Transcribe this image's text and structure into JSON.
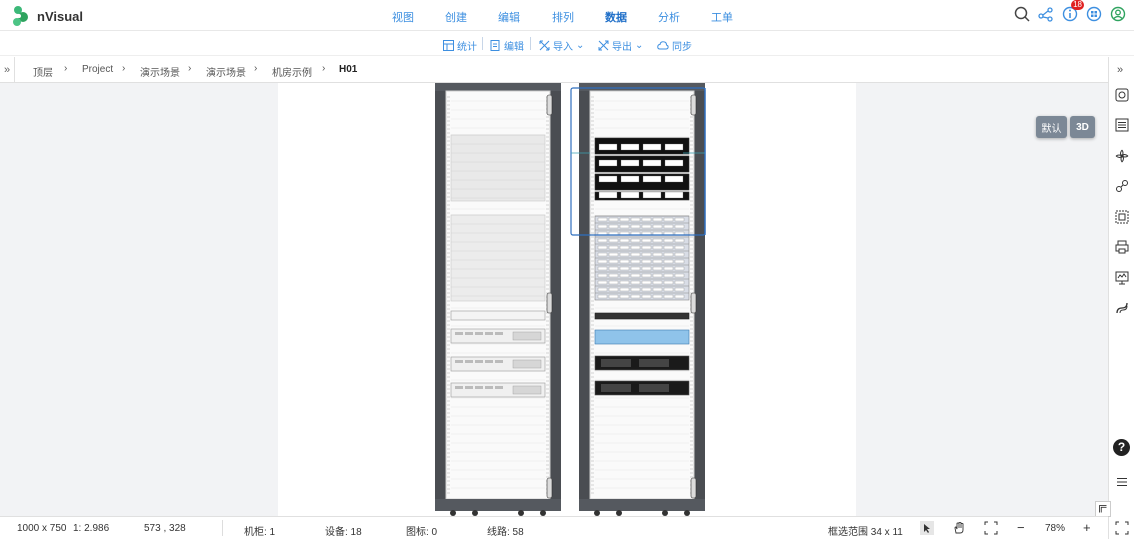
{
  "app": {
    "name": "nVisual"
  },
  "nav": {
    "items": [
      "视图",
      "创建",
      "编辑",
      "排列",
      "数据",
      "分析",
      "工单"
    ],
    "active": "数据"
  },
  "notifications": {
    "count": "18"
  },
  "subtoolbar": {
    "stats": "统计",
    "edit": "编辑",
    "import": "导入",
    "export": "导出",
    "sync": "同步"
  },
  "breadcrumb": [
    "顶层",
    "Project",
    "演示场景",
    "演示场景",
    "机房示例",
    "H01"
  ],
  "view_buttons": {
    "default": "默认",
    "three_d": "3D"
  },
  "status": {
    "canvas_size": "1000 x 750",
    "scale": "1: 2.986",
    "cursor": "573 , 328",
    "cabinets": "机柜: 1",
    "devices": "设备: 18",
    "icons": "图标: 0",
    "lines": "线路: 58",
    "selection": "框选范围  34 x 11",
    "zoom": "78%"
  },
  "colors": {
    "accent": "#3d8fe0",
    "rack": "#4a4d52",
    "selection": "#2f6fbf"
  }
}
